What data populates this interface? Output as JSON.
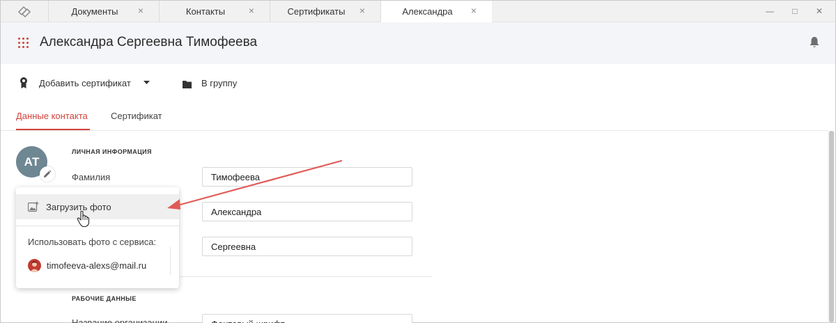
{
  "tabs": [
    {
      "label": "Документы",
      "close": "×"
    },
    {
      "label": "Контакты",
      "close": "×"
    },
    {
      "label": "Сертификаты",
      "close": "×"
    },
    {
      "label": "Александра",
      "close": "×"
    }
  ],
  "window": {
    "minimize": "—",
    "maximize": "□",
    "close": "✕"
  },
  "header": {
    "title": "Александра Сергеевна Тимофеева",
    "menu_icon": "apps-grid-icon",
    "bell_icon": "bell-icon"
  },
  "toolbar": {
    "add_certificate": "Добавить сертификат",
    "to_group": "В группу"
  },
  "content_tabs": {
    "contact_data": "Данные контакта",
    "certificate": "Сертификат"
  },
  "avatar": {
    "initials": "АТ"
  },
  "personal": {
    "section_title": "ЛИЧНАЯ ИНФОРМАЦИЯ",
    "last_name_label": "Фамилия",
    "last_name_value": "Тимофеева",
    "first_name_value": "Александра",
    "middle_name_value": "Сергеевна"
  },
  "work": {
    "section_title": "РАБОЧИЕ ДАННЫЕ",
    "org_label": "Название организации",
    "org_value": "Фонтовый шрифт"
  },
  "photo_menu": {
    "upload": "Загрузить фото",
    "use_service": "Использовать фото с сервиса:",
    "account": "timofeeva-alexs@mail.ru"
  },
  "colors": {
    "accent": "#d2413a",
    "header_bg": "#f4f5f8",
    "avatar_bg": "#6f8793",
    "annotation_arrow": "#e05a57"
  }
}
